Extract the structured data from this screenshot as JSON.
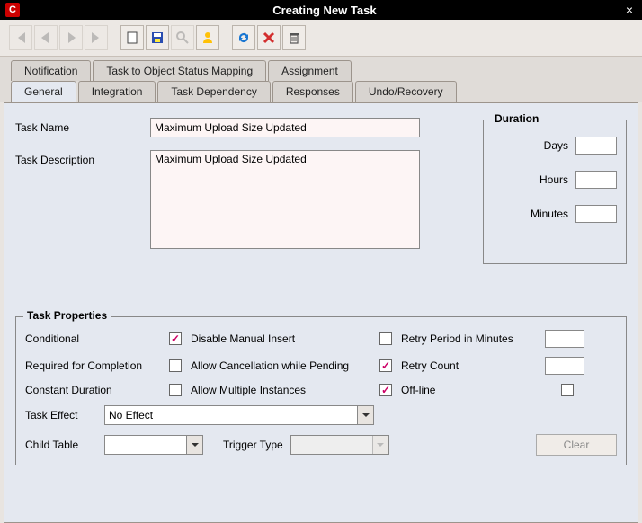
{
  "window": {
    "title": "Creating New Task",
    "appicon_letter": "C"
  },
  "tabs_row1": [
    {
      "label": "Notification"
    },
    {
      "label": "Task to Object Status Mapping"
    },
    {
      "label": "Assignment"
    }
  ],
  "tabs_row2": [
    {
      "label": "General",
      "active": true
    },
    {
      "label": "Integration"
    },
    {
      "label": "Task Dependency"
    },
    {
      "label": "Responses"
    },
    {
      "label": "Undo/Recovery"
    }
  ],
  "form": {
    "task_name_label": "Task Name",
    "task_name_value": "Maximum Upload Size Updated",
    "task_desc_label": "Task Description",
    "task_desc_value": "Maximum Upload Size Updated"
  },
  "duration": {
    "legend": "Duration",
    "days_label": "Days",
    "days_value": "",
    "hours_label": "Hours",
    "hours_value": "",
    "minutes_label": "Minutes",
    "minutes_value": ""
  },
  "task_properties": {
    "legend": "Task Properties",
    "conditional_label": "Conditional",
    "conditional_checked": true,
    "disable_manual_label": "Disable Manual Insert",
    "disable_manual_checked": false,
    "retry_period_label": "Retry Period in Minutes",
    "retry_period_value": "",
    "required_completion_label": "Required for Completion",
    "required_completion_checked": false,
    "allow_cancel_label": "Allow Cancellation while Pending",
    "allow_cancel_checked": true,
    "retry_count_label": "Retry Count",
    "retry_count_value": "",
    "constant_duration_label": "Constant Duration",
    "constant_duration_checked": false,
    "allow_multiple_label": "Allow Multiple Instances",
    "allow_multiple_checked": true,
    "offline_label": "Off-line",
    "offline_checked": false,
    "task_effect_label": "Task Effect",
    "task_effect_value": "No Effect",
    "child_table_label": "Child Table",
    "child_table_value": "",
    "trigger_type_label": "Trigger Type",
    "trigger_type_value": "",
    "clear_label": "Clear"
  }
}
